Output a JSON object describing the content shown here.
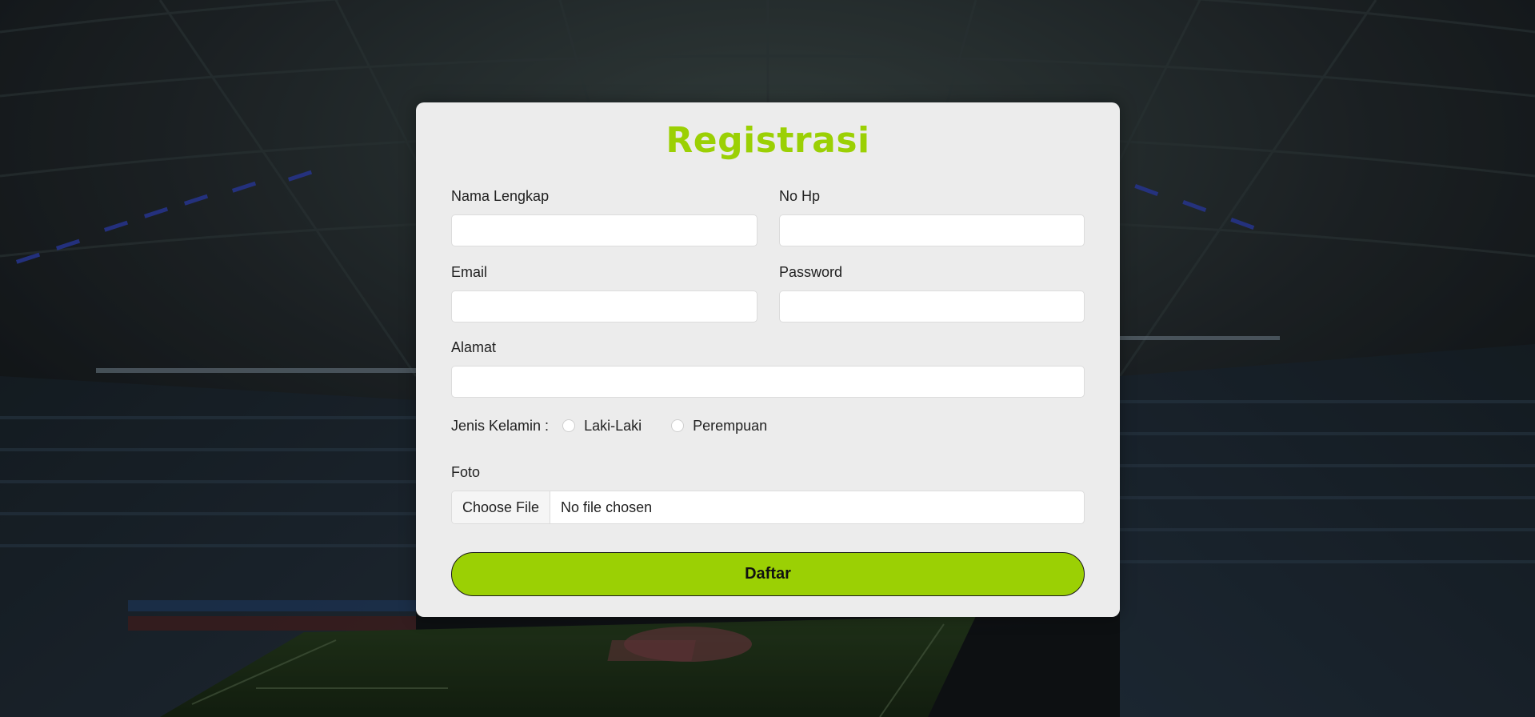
{
  "form": {
    "title": "Registrasi",
    "fields": {
      "nama_lengkap": {
        "label": "Nama Lengkap",
        "value": ""
      },
      "no_hp": {
        "label": "No Hp",
        "value": ""
      },
      "email": {
        "label": "Email",
        "value": ""
      },
      "password": {
        "label": "Password",
        "value": ""
      },
      "alamat": {
        "label": "Alamat",
        "value": ""
      }
    },
    "gender": {
      "label": "Jenis Kelamin :",
      "options": [
        "Laki-Laki",
        "Perempuan"
      ]
    },
    "foto": {
      "label": "Foto",
      "button_label": "Choose File",
      "status": "No file chosen"
    },
    "submit_label": "Daftar"
  },
  "colors": {
    "accent": "#9bd004",
    "card_bg": "#ececec"
  }
}
